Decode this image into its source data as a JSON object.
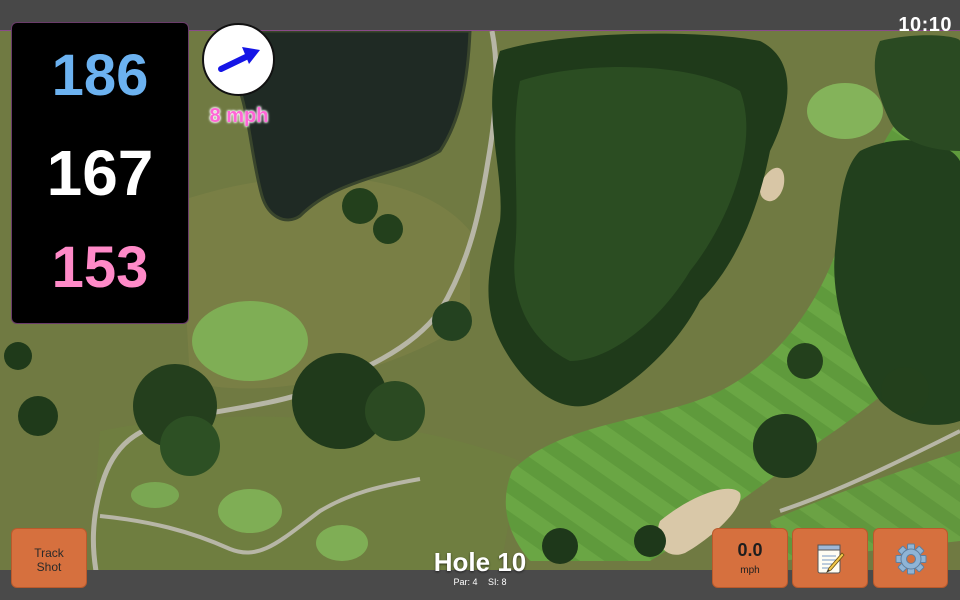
{
  "status_bar": {
    "time": "10:10"
  },
  "distances": {
    "back": "186",
    "middle": "167",
    "front": "153"
  },
  "wind": {
    "speed_label": "8 mph",
    "direction": "north-east"
  },
  "hole": {
    "title": "Hole 10",
    "par": "Par: 4",
    "si": "SI: 8"
  },
  "buttons": {
    "track_shot": {
      "line1": "Track",
      "line2": "Shot"
    },
    "speed": {
      "value": "0.0",
      "unit": "mph"
    },
    "notes": {
      "icon": "notepad-icon"
    },
    "settings": {
      "icon": "gear-icon"
    }
  },
  "colors": {
    "back_distance": "#6cb2f0",
    "middle_distance": "#ffffff",
    "front_distance": "#ff8ac8",
    "wind_label": "#ff66d6",
    "wind_arrow": "#1515e6",
    "button_orange": "#d6703e"
  }
}
